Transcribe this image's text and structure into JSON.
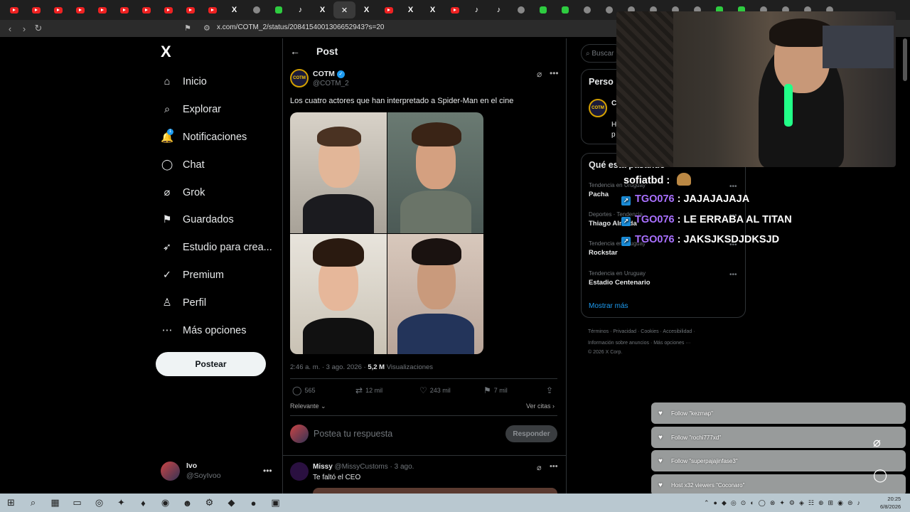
{
  "browser": {
    "tabs": [
      "yt",
      "yt",
      "yt",
      "yt",
      "yt",
      "yt",
      "yt",
      "yt",
      "yt",
      "yt",
      "x",
      "mute",
      "k",
      "tt",
      "x",
      "x-active",
      "x",
      "yt",
      "x",
      "x",
      "yt",
      "tt",
      "tt",
      "dia",
      "g",
      "g",
      "flash",
      "cam",
      "fold",
      "gen",
      "fold",
      "ms",
      "g",
      "g",
      "blue",
      "gen",
      "shield",
      "white"
    ],
    "close_glyph": "✕",
    "url": "x.com/COTM_2/status/2084154001306652943?s=20"
  },
  "nav": {
    "logo": "X",
    "items": [
      {
        "label": "Inicio",
        "icon": "home-icon",
        "glyph": "⌂"
      },
      {
        "label": "Explorar",
        "icon": "search-icon",
        "glyph": "⌕"
      },
      {
        "label": "Notificaciones",
        "icon": "bell-icon",
        "glyph": "🔔",
        "badge": "1"
      },
      {
        "label": "Chat",
        "icon": "chat-icon",
        "glyph": "◯"
      },
      {
        "label": "Grok",
        "icon": "grok-icon",
        "glyph": "⌀"
      },
      {
        "label": "Guardados",
        "icon": "bookmark-icon",
        "glyph": "⚑"
      },
      {
        "label": "Estudio para crea...",
        "icon": "rocket-icon",
        "glyph": "➶"
      },
      {
        "label": "Premium",
        "icon": "premium-icon",
        "glyph": "✓"
      },
      {
        "label": "Perfil",
        "icon": "profile-icon",
        "glyph": "♙"
      },
      {
        "label": "Más opciones",
        "icon": "more-options-icon",
        "glyph": "⋯"
      }
    ],
    "post_button": "Postear",
    "user": {
      "name": "Ivo",
      "handle": "@SoyIvoo"
    }
  },
  "post": {
    "header_title": "Post",
    "author_name": "COTM",
    "author_handle": "@COTM_2",
    "avatar_text": "COTM",
    "text": "Los cuatro actores que han interpretado a Spider-Man en el cine",
    "time": "2:46 a. m. · 3 ago. 2026 ·",
    "views": "5,2 M",
    "views_label": "Visualizaciones",
    "stats": {
      "replies": "565",
      "reposts": "12 mil",
      "likes": "243 mil",
      "bookmarks": "7 mil"
    },
    "sort_label": "Relevante",
    "see_quotes": "Ver citas",
    "reply_placeholder": "Postea tu respuesta",
    "reply_button": "Responder"
  },
  "comment": {
    "name": "Missy",
    "meta": "@MissyCustoms · 3 ago.",
    "text": "Te faltó el CEO"
  },
  "right": {
    "search_placeholder": "Buscar",
    "personas_title": "Perso",
    "personas_user_initial": "C",
    "personas_snippet": [
      "H",
      "p"
    ],
    "trends_title": "Qué está pasando",
    "trends": [
      {
        "category": "Tendencia en Uruguay",
        "name": "Pacha"
      },
      {
        "category": "Deportes · Tendencia",
        "name": "Thiago Almada"
      },
      {
        "category": "Tendencia en Uruguay",
        "name": "Rockstar"
      },
      {
        "category": "Tendencia en Uruguay",
        "name": "Estadio Centenario"
      }
    ],
    "show_more": "Mostrar más",
    "footer_lines": [
      "Términos · Privacidad · Cookies · Accesibilidad ·",
      "Información sobre anuncios · Más opciones ···",
      "© 2026 X Corp."
    ]
  },
  "stream": {
    "chat": [
      {
        "user": "sofiatbd",
        "message": "",
        "badge": false
      },
      {
        "user": "TGO076",
        "message": "JAJAJAJAJA",
        "badge": true
      },
      {
        "user": "TGO076",
        "message": "LE ERRABA AL TITAN",
        "badge": true
      },
      {
        "user": "TGO076",
        "message": "JAKSJKSDJDKSJD",
        "badge": true
      }
    ],
    "alerts": [
      "Follow \"kezmap\"",
      "Follow \"rochi777xd\"",
      "Follow \"superpajajinfase3\"",
      "Host x32 viewers \"Coconaro\""
    ]
  },
  "taskbar": {
    "time": "20:25",
    "date": "6/8/2026"
  },
  "colors": {
    "accent": "#1d9bf0",
    "twitch_purple": "#a970ff"
  }
}
